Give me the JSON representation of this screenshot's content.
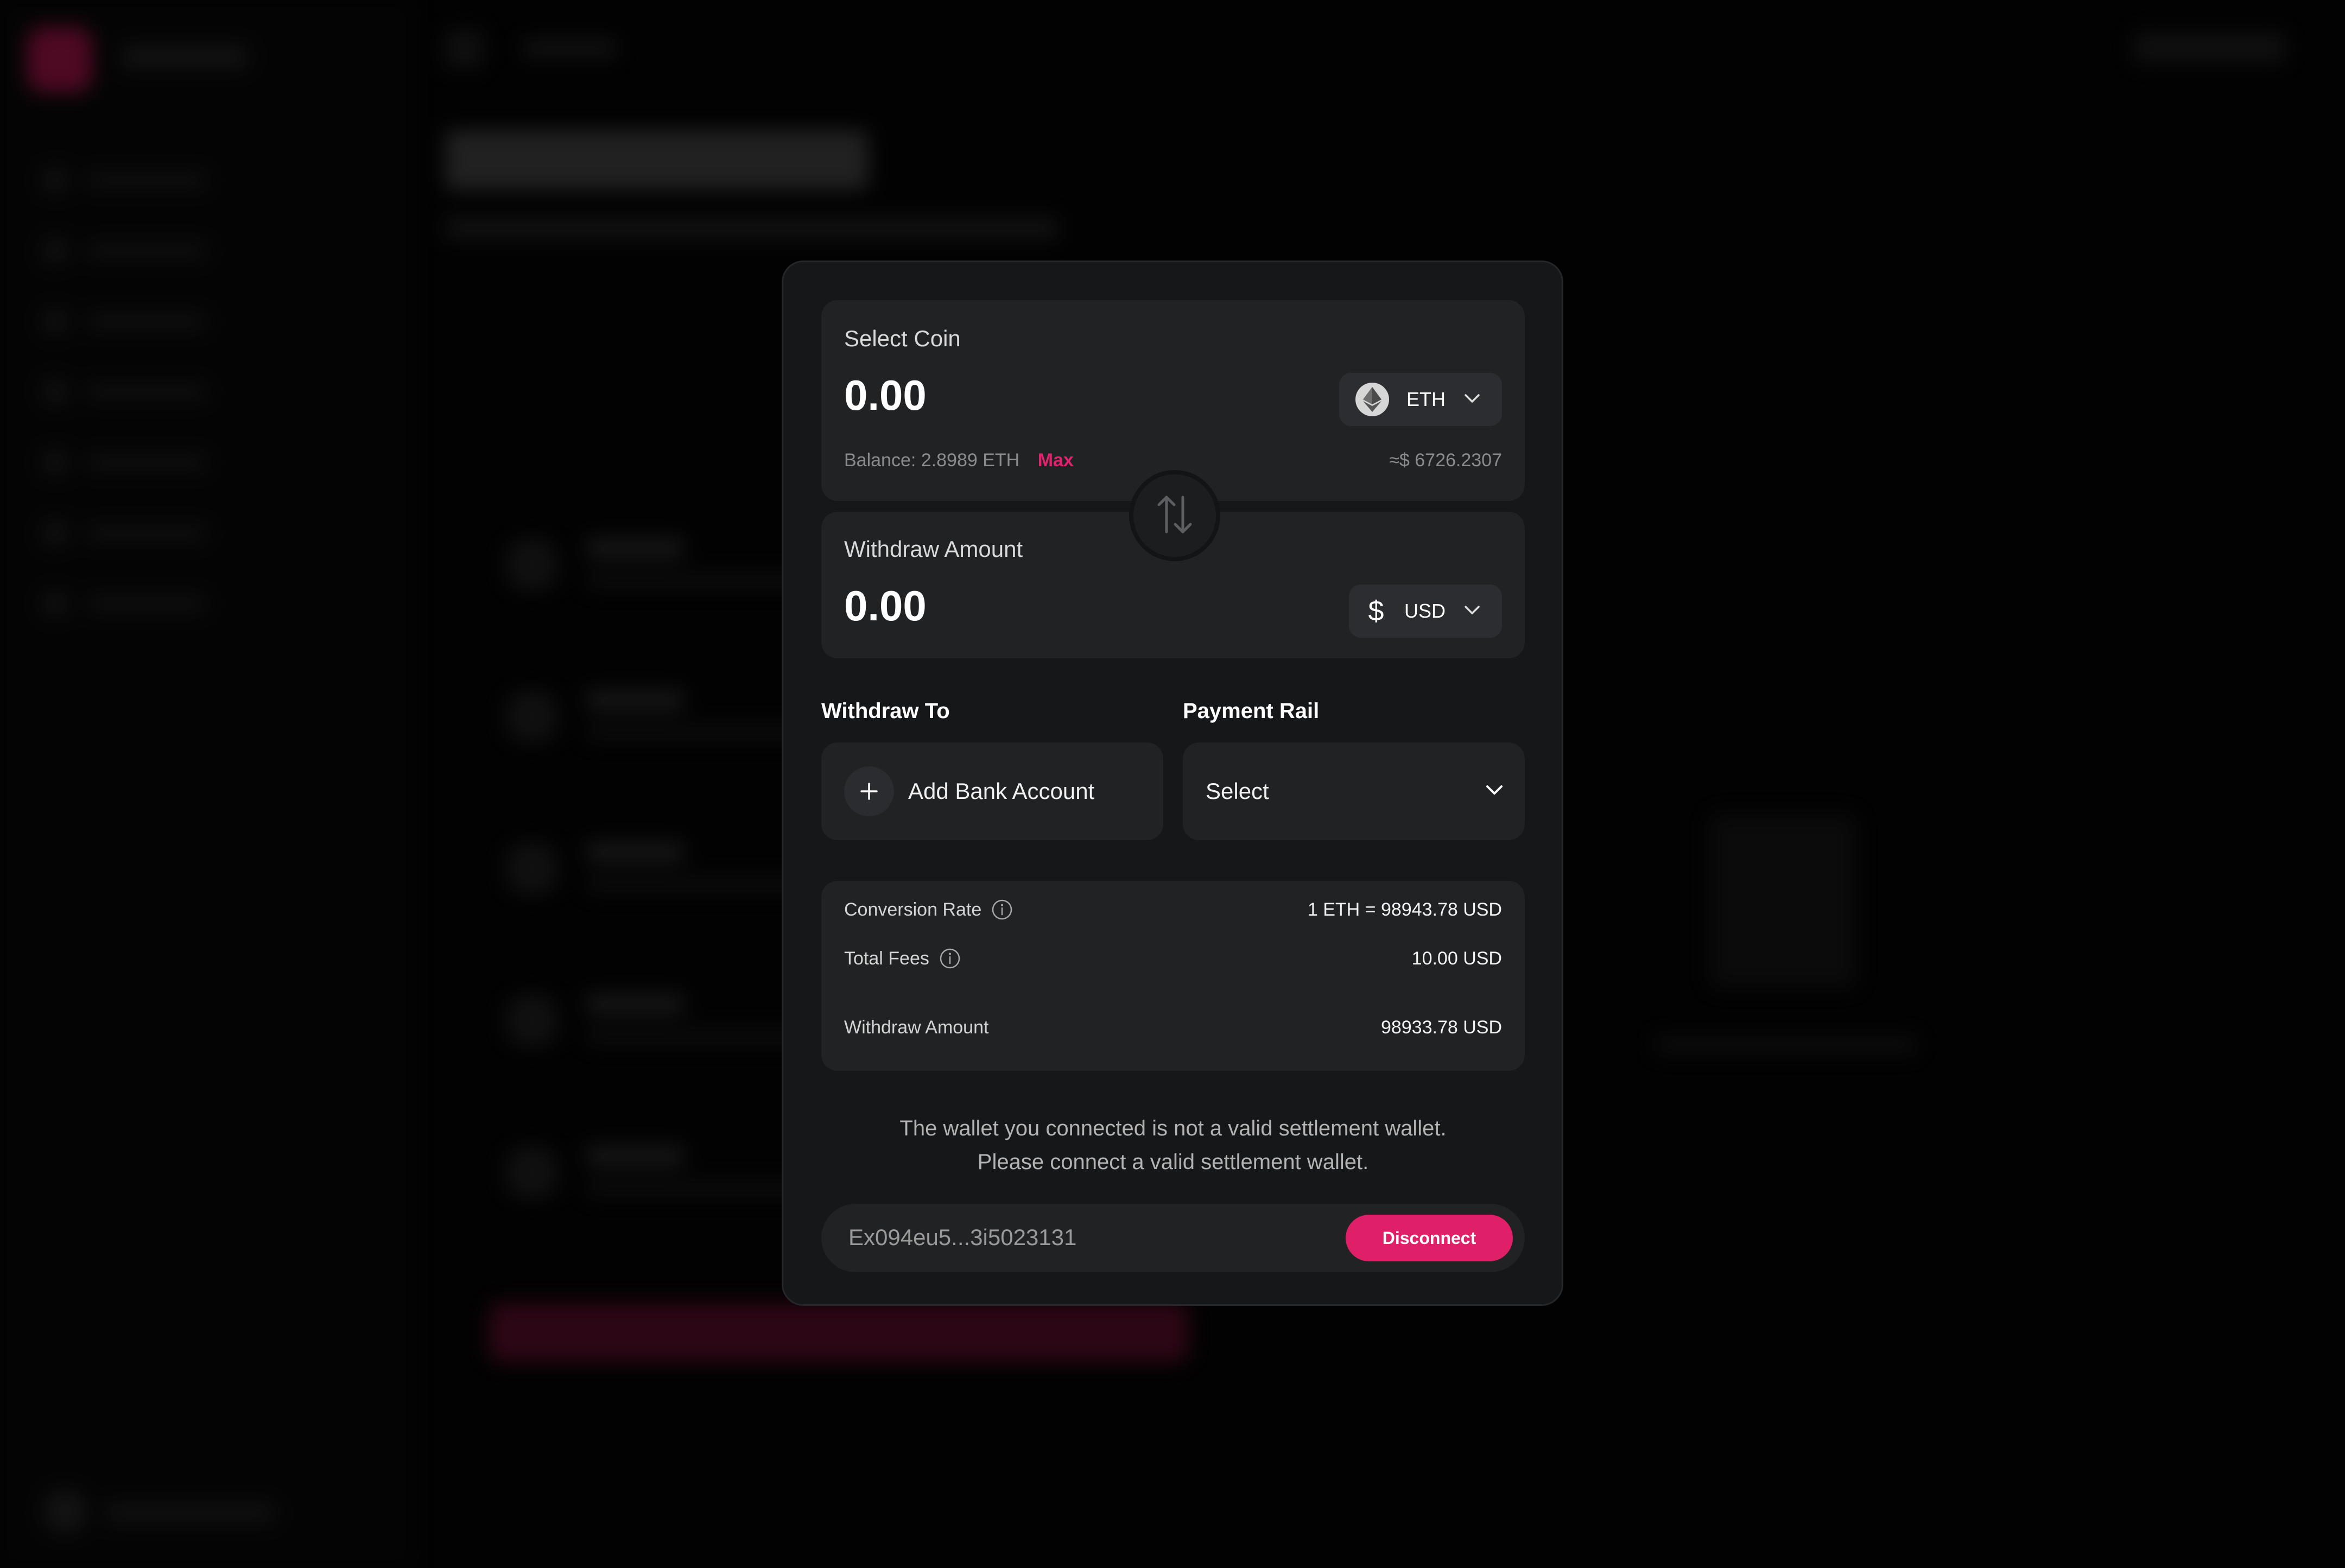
{
  "modal": {
    "select_coin": {
      "label": "Select Coin",
      "value": "0.00",
      "coin": "ETH",
      "balance_label": "Balance:",
      "balance_value": "2.8989 ETH",
      "max_label": "Max",
      "usd_equivalent": "≈$ 6726.2307"
    },
    "withdraw_amount": {
      "label": "Withdraw Amount",
      "value": "0.00",
      "currency": "USD"
    },
    "withdraw_to": {
      "label": "Withdraw To",
      "add_bank_label": "Add Bank Account"
    },
    "payment_rail": {
      "label": "Payment Rail",
      "selected": "Select"
    },
    "summary": {
      "conversion_rate_label": "Conversion Rate",
      "conversion_rate_value": "1 ETH = 98943.78 USD",
      "total_fees_label": "Total Fees",
      "total_fees_value": "10.00 USD",
      "withdraw_amount_label": "Withdraw Amount",
      "withdraw_amount_value": "98933.78 USD"
    },
    "warning": {
      "line1": "The wallet you connected is not a valid settlement wallet.",
      "line2": "Please connect a valid settlement wallet."
    },
    "wallet": {
      "address": "Ex094eu5...3i5023131",
      "disconnect_label": "Disconnect"
    }
  },
  "colors": {
    "accent": "#df1f68",
    "modal_bg": "#161718",
    "card_bg": "#202224",
    "page_bg": "#040404"
  },
  "icons": [
    "ethereum-icon",
    "chevron-down-icon",
    "dollar-icon",
    "swap-arrows-icon",
    "plus-icon",
    "info-icon"
  ]
}
